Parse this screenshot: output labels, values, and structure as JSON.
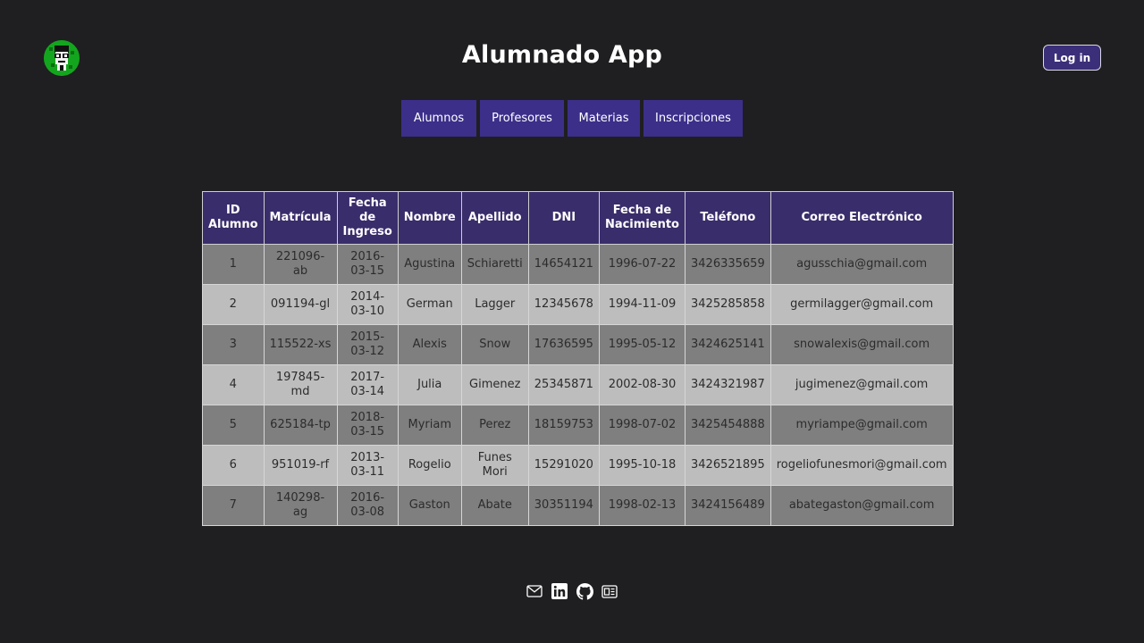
{
  "header": {
    "title": "Alumnado App",
    "login_label": "Log in"
  },
  "nav": {
    "tabs": [
      {
        "label": "Alumnos"
      },
      {
        "label": "Profesores"
      },
      {
        "label": "Materias"
      },
      {
        "label": "Inscripciones"
      }
    ]
  },
  "table": {
    "columns": [
      "ID Alumno",
      "Matrícula",
      "Fecha de Ingreso",
      "Nombre",
      "Apellido",
      "DNI",
      "Fecha de Nacimiento",
      "Teléfono",
      "Correo Electrónico"
    ],
    "rows": [
      [
        "1",
        "221096-ab",
        "2016-03-15",
        "Agustina",
        "Schiaretti",
        "14654121",
        "1996-07-22",
        "3426335659",
        "agusschia@gmail.com"
      ],
      [
        "2",
        "091194-gl",
        "2014-03-10",
        "German",
        "Lagger",
        "12345678",
        "1994-11-09",
        "3425285858",
        "germilagger@gmail.com"
      ],
      [
        "3",
        "115522-xs",
        "2015-03-12",
        "Alexis",
        "Snow",
        "17636595",
        "1995-05-12",
        "3424625141",
        "snowalexis@gmail.com"
      ],
      [
        "4",
        "197845-md",
        "2017-03-14",
        "Julia",
        "Gimenez",
        "25345871",
        "2002-08-30",
        "3424321987",
        "jugimenez@gmail.com"
      ],
      [
        "5",
        "625184-tp",
        "2018-03-15",
        "Myriam",
        "Perez",
        "18159753",
        "1998-07-02",
        "3425454888",
        "myriampe@gmail.com"
      ],
      [
        "6",
        "951019-rf",
        "2013-03-11",
        "Rogelio",
        "Funes Mori",
        "15291020",
        "1995-10-18",
        "3426521895",
        "rogeliofunesmori@gmail.com"
      ],
      [
        "7",
        "140298-ag",
        "2016-03-08",
        "Gaston",
        "Abate",
        "30351194",
        "1998-02-13",
        "3424156489",
        "abategaston@gmail.com"
      ]
    ]
  },
  "footer": {
    "icons": [
      "mail-icon",
      "linkedin-icon",
      "github-icon",
      "newspaper-icon"
    ]
  },
  "colors": {
    "background": "#1f1f21",
    "accent": "#3b2f8a",
    "table_header": "#3a2d6b",
    "row_dark": "#7f7f7f",
    "row_light": "#bdbdbd"
  }
}
